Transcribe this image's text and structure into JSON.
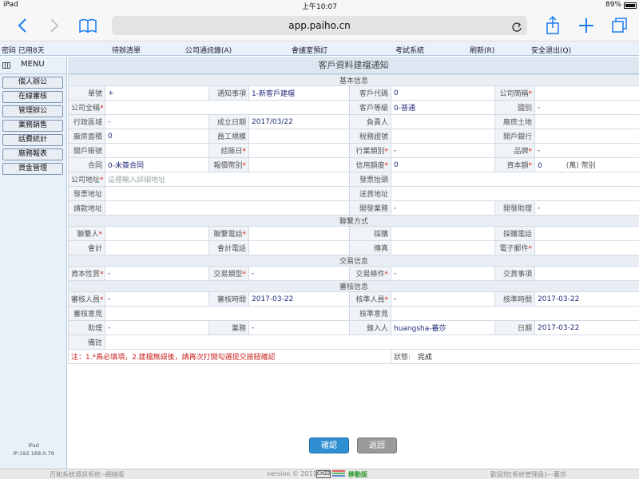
{
  "status": {
    "device": "iPad",
    "time": "上午10:07",
    "battery": "89%"
  },
  "browser": {
    "url": "app.paiho.cn"
  },
  "menubar": {
    "items": [
      "密码 已用8天",
      "待辦清單",
      "公司通訊錄(A)",
      "會議室預訂",
      "考試系統",
      "刷新(R)",
      "安全退出(Q)"
    ]
  },
  "sidebar": {
    "title": "MENU",
    "items": [
      "個人辦公",
      "在線審核",
      "管理辦公",
      "業務銷售",
      "話費統計",
      "廠務報表",
      "資金管理"
    ],
    "footer_device": "iPad",
    "footer_ip": "IP:192.168.0.79"
  },
  "form": {
    "title": "客戶資料建檔通知",
    "sections": {
      "basic": "基本信息",
      "contact": "聯繫方式",
      "trade": "交易信息",
      "review": "審核信息"
    },
    "labels": {
      "order_no": "單號",
      "notice": "通知事項",
      "cust_code": "客戶代碼",
      "company_short": "公司簡稱",
      "company_full": "公司全稱",
      "cust_level": "客戶等級",
      "country": "國別",
      "region": "行政區域",
      "founded": "成立日期",
      "owner": "負責人",
      "factory_land": "廠房土地",
      "factory_area": "廠房面積",
      "staff": "員工規模",
      "tax_id": "稅務證號",
      "bank": "開戶銀行",
      "account": "開戶賬號",
      "settle_day": "結賬日",
      "industry": "行業類別",
      "brand": "品牌",
      "contract": "合同",
      "quote_currency": "報價幣別",
      "credit": "信用額度",
      "capital": "資本額",
      "capital_unit": "(萬) 幣別",
      "address": "公司地址",
      "invoice_title": "發票抬頭",
      "invoice_addr": "發票地址",
      "delivery_addr": "送貨地址",
      "billing_addr": "請款地址",
      "dev_sales": "開發業務",
      "dev_assistant": "開發助理",
      "contact_person": "聯繫人",
      "contact_phone": "聯繫電話",
      "purchase": "採購",
      "purchase_phone": "採購電話",
      "accountant": "會計",
      "accountant_phone": "會計電話",
      "fax": "傳真",
      "email": "電子郵件",
      "capital_nature": "資本性質",
      "trade_type": "交易類型",
      "trade_terms": "交易條件",
      "trade_items": "交貨事項",
      "reviewer": "審核人員",
      "review_time": "審核時間",
      "approver": "核準人員",
      "approve_time": "核準時間",
      "review_opinion": "審核意見",
      "approve_opinion": "核準意見",
      "assistant": "助理",
      "business": "業務",
      "entry_person": "錄入人",
      "date": "日期",
      "remark": "備註",
      "state": "狀態:"
    },
    "values": {
      "order_no": "+",
      "notice": "1-新客戶建檔",
      "cust_code": "0",
      "cust_level": "0-普通",
      "country": "-",
      "region": "-",
      "founded": "2017/03/22",
      "factory_area": "0",
      "industry": "-",
      "brand": "-",
      "contract": "0-未簽合同",
      "credit": "0",
      "capital": "0",
      "address_placeholder": "這裡輸入詳細地址",
      "dev_sales": "-",
      "dev_assistant": "-",
      "capital_nature": "-",
      "trade_type": "-",
      "trade_terms": "-",
      "reviewer": "-",
      "review_time": "2017-03-22",
      "approver": "-",
      "approve_time": "2017-03-22",
      "assistant": "-",
      "business": "-",
      "entry_person": "huangsha-蕃莎",
      "date": "2017-03-22",
      "state": "完成"
    },
    "note": "注：1.*爲必填項，2.建檔無誤後，請再次打開勾選提交按鈕確認"
  },
  "buttons": {
    "confirm": "確認",
    "back": "返回"
  },
  "footer": {
    "left": "百和系統資訊系統--網絡版",
    "version": "version © 2011",
    "logo": "CHZZ",
    "mobile": "移動版",
    "right": "歡迎您[系統管理員]---蕃莎"
  },
  "colors": {
    "accent": "#1a7cf2",
    "required": "#d81c1c",
    "value_text": "#1f2c7a",
    "confirm_btn": "#2f8fd2",
    "back_btn": "#9a9a9a"
  }
}
